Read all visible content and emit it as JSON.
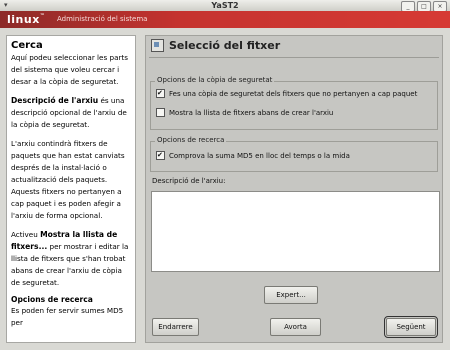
{
  "window": {
    "title": "YaST2"
  },
  "banner": {
    "logo": "linux",
    "subtitle": "Administració del sistema"
  },
  "help": {
    "title": "Cerca",
    "p1": "Aquí podeu seleccionar les parts del sistema que voleu cercar i desar a la còpia de seguretat.",
    "p2_bold": "Descripció de l'arxiu",
    "p2_rest": "és una descripció opcional de l'arxiu de la còpia de seguretat.",
    "p3": "L'arxiu contindrà fitxers de paquets que han estat canviats després de la instal·lació o actualització dels paquets. Aquests fitxers no pertanyen a cap paquet i es poden afegir a l'arxiu de forma opcional.",
    "p4_pre": "Activeu",
    "p4_bold": "Mostra la llista de fitxers...",
    "p4_rest": "per mostrar i editar la llista de fitxers que s'han trobat abans de crear l'arxiu de còpia de seguretat.",
    "section": "Opcions de recerca",
    "p5": "Es poden fer servir sumes MD5 per"
  },
  "main": {
    "title": "Selecció del fitxer",
    "backup_options": {
      "label": "Opcions de la còpia de seguretat",
      "opt1": "Fes una còpia de seguretat dels fitxers que no pertanyen a cap paquet",
      "opt1_checked": true,
      "opt2": "Mostra la llista de fitxers abans de crear l'arxiu",
      "opt2_checked": false
    },
    "search_options": {
      "label": "Opcions de recerca",
      "opt1": "Comprova la suma MD5 en lloc del temps o la mida",
      "opt1_checked": true
    },
    "description": {
      "label": "Descripció de l'arxiu:",
      "value": ""
    },
    "buttons": {
      "expert": "Expert...",
      "back": "Endarrere",
      "abort": "Avorta",
      "next": "Següent"
    }
  }
}
